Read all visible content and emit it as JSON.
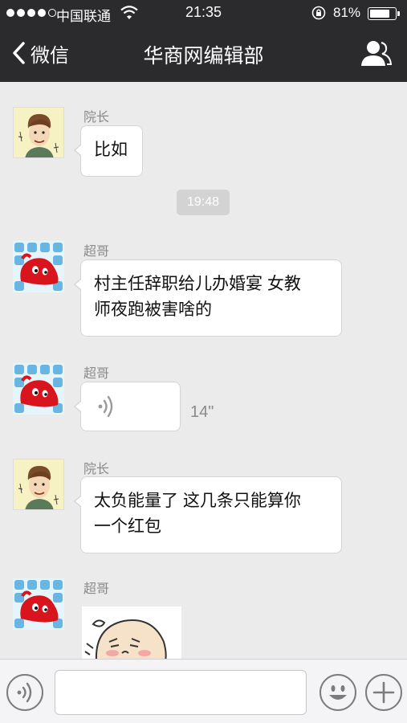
{
  "status_bar": {
    "carrier": "中国联通",
    "time": "21:35",
    "battery": "81%",
    "battery_level": 0.81
  },
  "nav": {
    "back_label": "微信",
    "title": "华商网编辑部"
  },
  "messages": [
    {
      "sender": "院长",
      "text": "比如"
    },
    {
      "timestamp": "19:48"
    },
    {
      "sender": "超哥",
      "lines": [
        "村主任辞职给儿办婚宴 女教",
        "师夜跑被害啥的"
      ]
    },
    {
      "sender": "超哥",
      "voice_duration": "14\""
    },
    {
      "sender": "院长",
      "lines": [
        "太负能量了 这几条只能算你",
        "一个红包"
      ]
    },
    {
      "sender": "超哥",
      "sticker": "blushing-face-sticker"
    }
  ],
  "input_bar": {
    "icons": [
      "voice-icon",
      "emoji-icon",
      "plus-icon"
    ]
  },
  "colors": {
    "nav_bg": "#2b2b2d",
    "chat_bg": "#ebebeb",
    "bubble": "#ffffff"
  }
}
